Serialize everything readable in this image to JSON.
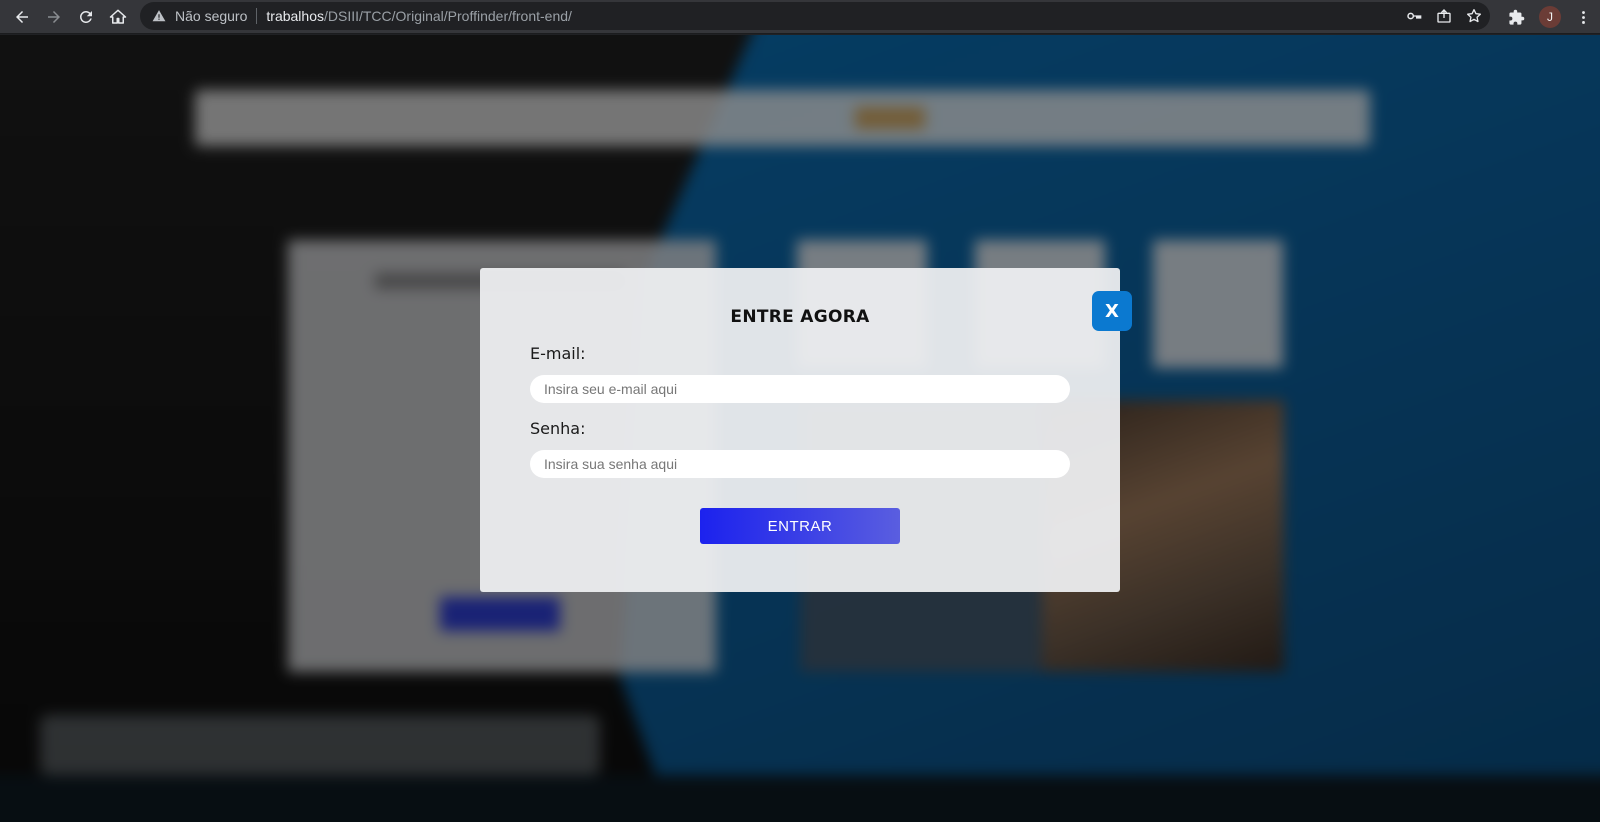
{
  "browser": {
    "security_label": "Não seguro",
    "url_host": "trabalhos",
    "url_path": "/DSIII/TCC/Original/Proffinder/front-end/",
    "profile_initial": "J",
    "icons": [
      "back-icon",
      "forward-icon",
      "reload-icon",
      "home-icon",
      "warning-icon",
      "key-icon",
      "share-icon",
      "star-icon",
      "extensions-icon",
      "menu-icon"
    ]
  },
  "login_modal": {
    "title": "ENTRE AGORA",
    "email_label": "E-mail:",
    "email_placeholder": "Insira seu e-mail aqui",
    "email_value": "",
    "password_label": "Senha:",
    "password_placeholder": "Insira sua senha aqui",
    "password_value": "",
    "submit_label": "ENTRAR",
    "close_label": "X"
  },
  "colors": {
    "submit_gradient_start": "#1c22ee",
    "submit_gradient_end": "#5a5ee0",
    "close_button": "#0b79d0",
    "page_accent_blue": "#0a6fb5"
  }
}
